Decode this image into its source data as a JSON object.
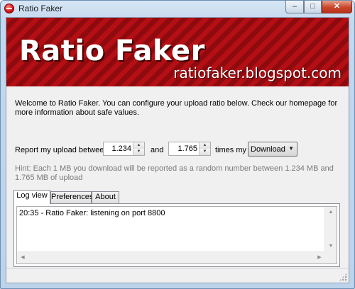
{
  "window": {
    "title": "Ratio Faker"
  },
  "banner": {
    "title": "Ratio Faker",
    "url": "ratiofaker.blogspot.com"
  },
  "welcome_text": "Welcome to Ratio Faker. You can configure your upload ratio below. Check our homepage for more information about safe values.",
  "report": {
    "label": "Report my upload between",
    "min_value": "1.234",
    "and_label": "and",
    "max_value": "1.765",
    "times_label": "times my",
    "mode_selected": "Download"
  },
  "hint": "Hint: Each 1 MB you download will be reported as a random number between 1.234 MB and 1.765 MB of upload",
  "tabs": [
    {
      "label": "Log view",
      "active": true
    },
    {
      "label": "Preferences",
      "active": false
    },
    {
      "label": "About",
      "active": false
    }
  ],
  "log": [
    "20:35 - Ratio Faker: listening on port 8800"
  ],
  "colors": {
    "banner_red": "#b40f14",
    "banner_stripe": "#8f0a0e",
    "close_button": "#c9462c"
  }
}
